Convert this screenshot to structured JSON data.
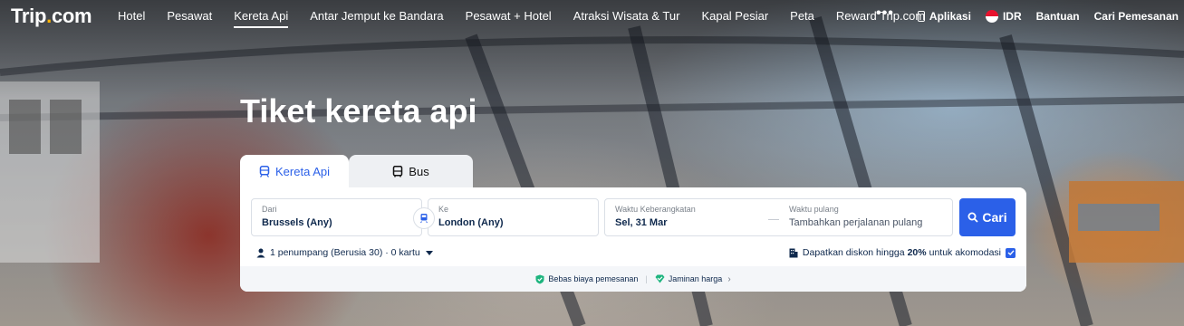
{
  "brand": {
    "name": "Trip",
    "dot": ".",
    "suffix": "com"
  },
  "nav": {
    "items": [
      {
        "label": "Hotel"
      },
      {
        "label": "Pesawat"
      },
      {
        "label": "Kereta Api",
        "active": true
      },
      {
        "label": "Antar Jemput ke Bandara"
      },
      {
        "label": "Pesawat + Hotel"
      },
      {
        "label": "Atraksi Wisata & Tur"
      },
      {
        "label": "Kapal Pesiar"
      },
      {
        "label": "Peta"
      },
      {
        "label": "Reward Trip.com"
      }
    ],
    "more": "•••",
    "right": {
      "app": "Aplikasi",
      "currency": "IDR",
      "help": "Bantuan",
      "bookings": "Cari Pemesanan"
    }
  },
  "hero": {
    "title": "Tiket kereta api"
  },
  "tabs": [
    {
      "label": "Kereta Api"
    },
    {
      "label": "Bus"
    }
  ],
  "search": {
    "from": {
      "label": "Dari",
      "value": "Brussels (Any)"
    },
    "to": {
      "label": "Ke",
      "value": "London (Any)"
    },
    "depart": {
      "label": "Waktu Keberangkatan",
      "value": "Sel, 31 Mar"
    },
    "return": {
      "label": "Waktu pulang",
      "placeholder": "Tambahkan perjalanan pulang"
    },
    "button": "Cari",
    "passengers": "1 penumpang (Berusia 30) · 0 kartu",
    "promo": {
      "prefix": "Dapatkan diskon hingga",
      "percent": "20%",
      "suffix": "untuk akomodasi",
      "checked": true
    }
  },
  "badges": {
    "fee": "Bebas biaya pemesanan",
    "price": "Jaminan harga"
  },
  "colors": {
    "accent": "#2b60e8",
    "logo_dot": "#ffb400",
    "text_dark": "#0f294d"
  }
}
